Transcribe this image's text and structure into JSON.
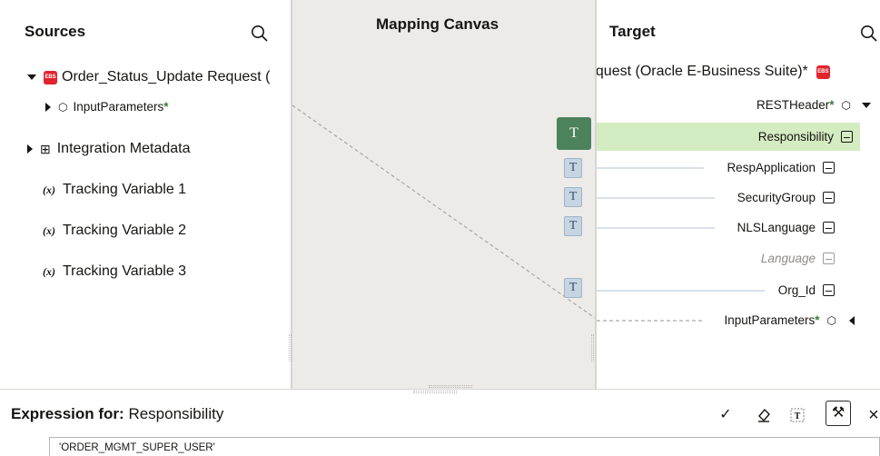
{
  "sources": {
    "title": "Sources",
    "items": [
      {
        "label": "Order_Status_Update Request (",
        "icon": "ebs-icon"
      },
      {
        "label": "InputParameters",
        "required": "*"
      },
      {
        "label": "Integration Metadata"
      },
      {
        "fx": "(x)",
        "label": "Tracking Variable 1"
      },
      {
        "fx": "(x)",
        "label": "Tracking Variable 2"
      },
      {
        "fx": "(x)",
        "label": "Tracking Variable 3"
      }
    ]
  },
  "canvas": {
    "title": "Mapping Canvas",
    "chip_label": "T"
  },
  "target": {
    "title": "Target",
    "root": "equest (Oracle E-Business Suite)*",
    "items": [
      {
        "label": "RESTHeader",
        "required": "*"
      },
      {
        "label": "Responsibility"
      },
      {
        "label": "RespApplication"
      },
      {
        "label": "SecurityGroup"
      },
      {
        "label": "NLSLanguage"
      },
      {
        "label": "Language"
      },
      {
        "label": "Org_Id"
      },
      {
        "label": "InputParameters",
        "required": "*"
      }
    ]
  },
  "expression": {
    "label_bold": "Expression for:",
    "label_field": "Responsibility",
    "value": "'ORDER_MGMT_SUPER_USER'",
    "tools": {
      "check": "✓",
      "eraser": "⌫",
      "text": "T",
      "wrench": "⚒",
      "close": "×"
    }
  },
  "colors": {
    "mapped": "#4c825c",
    "highlight": "#d4ecc1",
    "chip": "#c7d4e1"
  },
  "ebs_badge": "EBS"
}
